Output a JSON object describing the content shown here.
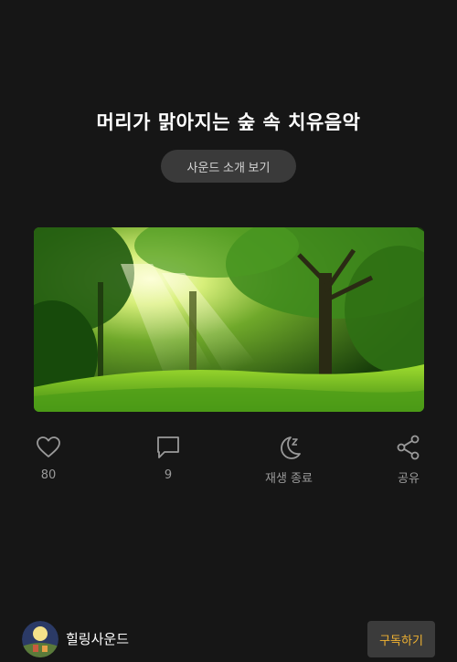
{
  "header": {
    "title": "머리가 맑아지는 숲 속 치유음악",
    "intro_button": "사운드 소개 보기"
  },
  "hero_image": {
    "description_icon": "forest-image"
  },
  "actions": {
    "like": {
      "icon": "heart-icon",
      "label": "80"
    },
    "comment": {
      "icon": "comment-icon",
      "label": "9"
    },
    "sleep_timer": {
      "icon": "moon-sleep-icon",
      "label": "재생 종료"
    },
    "share": {
      "icon": "share-icon",
      "label": "공유"
    }
  },
  "footer": {
    "channel_name": "힐링사운드",
    "subscribe_label": "구독하기"
  },
  "colors": {
    "background": "#161616",
    "subscribe_text": "#f0b232",
    "icon_gray": "#9a9a9a"
  }
}
